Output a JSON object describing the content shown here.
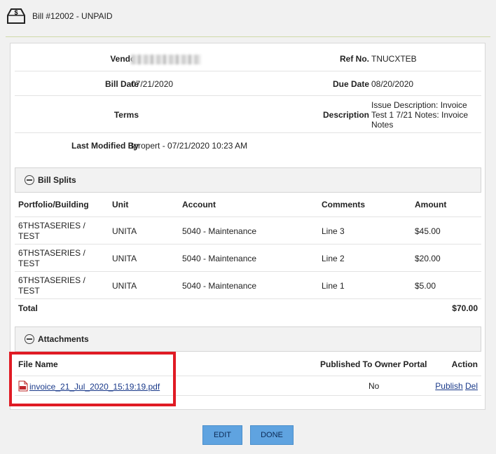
{
  "header": {
    "title": "Bill #12002 - UNPAID"
  },
  "info": {
    "vendor_label": "Vendor",
    "vendor_value": "",
    "refno_label": "Ref No.",
    "refno_value": "TNUCXTEB",
    "billdate_label": "Bill Date",
    "billdate_value": "07/21/2020",
    "duedate_label": "Due Date",
    "duedate_value": "08/20/2020",
    "terms_label": "Terms",
    "terms_value": "",
    "description_label": "Description",
    "description_value": "Issue Description: Invoice Test 1 7/21 Notes: Invoice Notes",
    "lastmod_label": "Last Modified By",
    "lastmod_value": "tpropert - 07/21/2020 10:23 AM"
  },
  "splits": {
    "title": "Bill Splits",
    "headers": [
      "Portfolio/Building",
      "Unit",
      "Account",
      "Comments",
      "Amount"
    ],
    "rows": [
      {
        "portfolio": "6THSTASERIES / TEST",
        "unit": "UNITA",
        "account": "5040 - Maintenance",
        "comments": "Line 3",
        "amount": "$45.00"
      },
      {
        "portfolio": "6THSTASERIES / TEST",
        "unit": "UNITA",
        "account": "5040 - Maintenance",
        "comments": "Line 2",
        "amount": "$20.00"
      },
      {
        "portfolio": "6THSTASERIES / TEST",
        "unit": "UNITA",
        "account": "5040 - Maintenance",
        "comments": "Line 1",
        "amount": "$5.00"
      }
    ],
    "total_label": "Total",
    "total_value": "$70.00"
  },
  "attachments": {
    "title": "Attachments",
    "headers": {
      "file_name": "File Name",
      "published": "Published To Owner Portal",
      "action": "Action"
    },
    "rows": [
      {
        "file": "invoice_21_Jul_2020_15:19:19.pdf",
        "published": "No",
        "publish_link": "Publish",
        "delete_link": "Del"
      }
    ]
  },
  "buttons": {
    "edit": "EDIT",
    "done": "DONE"
  },
  "colors": {
    "accent_button": "#5fa3e0",
    "highlight_border": "#e01b24",
    "link": "#1a3a8a"
  },
  "icons": {
    "bill": "bill-dollar-icon",
    "collapse": "minus-circle-icon",
    "file": "pdf-file-icon"
  }
}
